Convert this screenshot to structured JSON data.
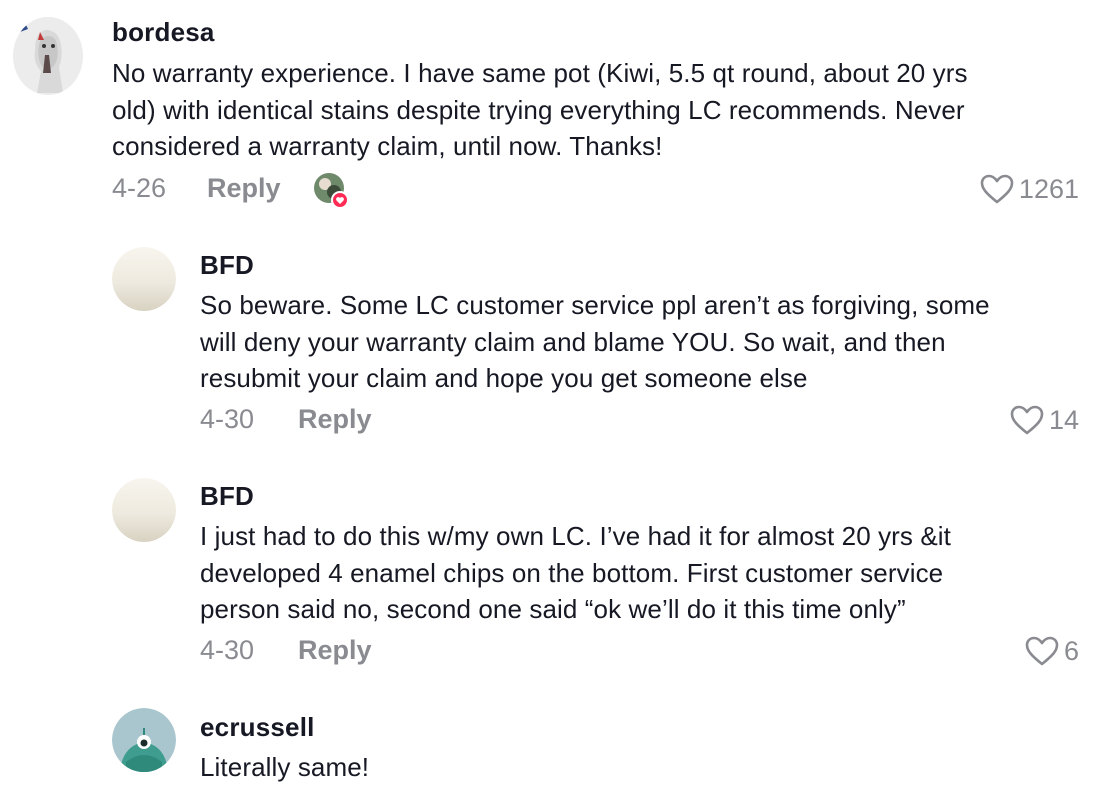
{
  "comments": [
    {
      "username": "bordesa",
      "text": "No warranty experience. I have same pot (Kiwi, 5.5 qt round, about 20 yrs\nold) with identical stains despite trying everything LC recommends. Never\nconsidered a warranty claim, until now. Thanks!",
      "date": "4-26",
      "reply_label": "Reply",
      "likes": "1261",
      "avatar_icon": "horse-avatar",
      "creator_liked": true
    },
    {
      "username": "BFD",
      "text": "So beware. Some LC customer service ppl aren’t as forgiving, some\nwill deny your warranty claim and blame YOU. So wait, and then\nresubmit your claim and hope you get someone else",
      "date": "4-30",
      "reply_label": "Reply",
      "likes": "14",
      "avatar_icon": "blank-cream-avatar"
    },
    {
      "username": "BFD",
      "text": "I just had to do this w/my own LC. I’ve had it for almost 20 yrs &it\ndeveloped 4 enamel chips on the bottom. First customer service\nperson said no, second one said “ok we’ll do it this time only”",
      "date": "4-30",
      "reply_label": "Reply",
      "likes": "6",
      "avatar_icon": "blank-cream-avatar"
    },
    {
      "username": "ecrussell",
      "text": "Literally same!",
      "avatar_icon": "teal-monster-avatar"
    }
  ],
  "colors": {
    "text": "#161823",
    "muted": "#8a8b91",
    "like_badge": "#fe2c55"
  }
}
